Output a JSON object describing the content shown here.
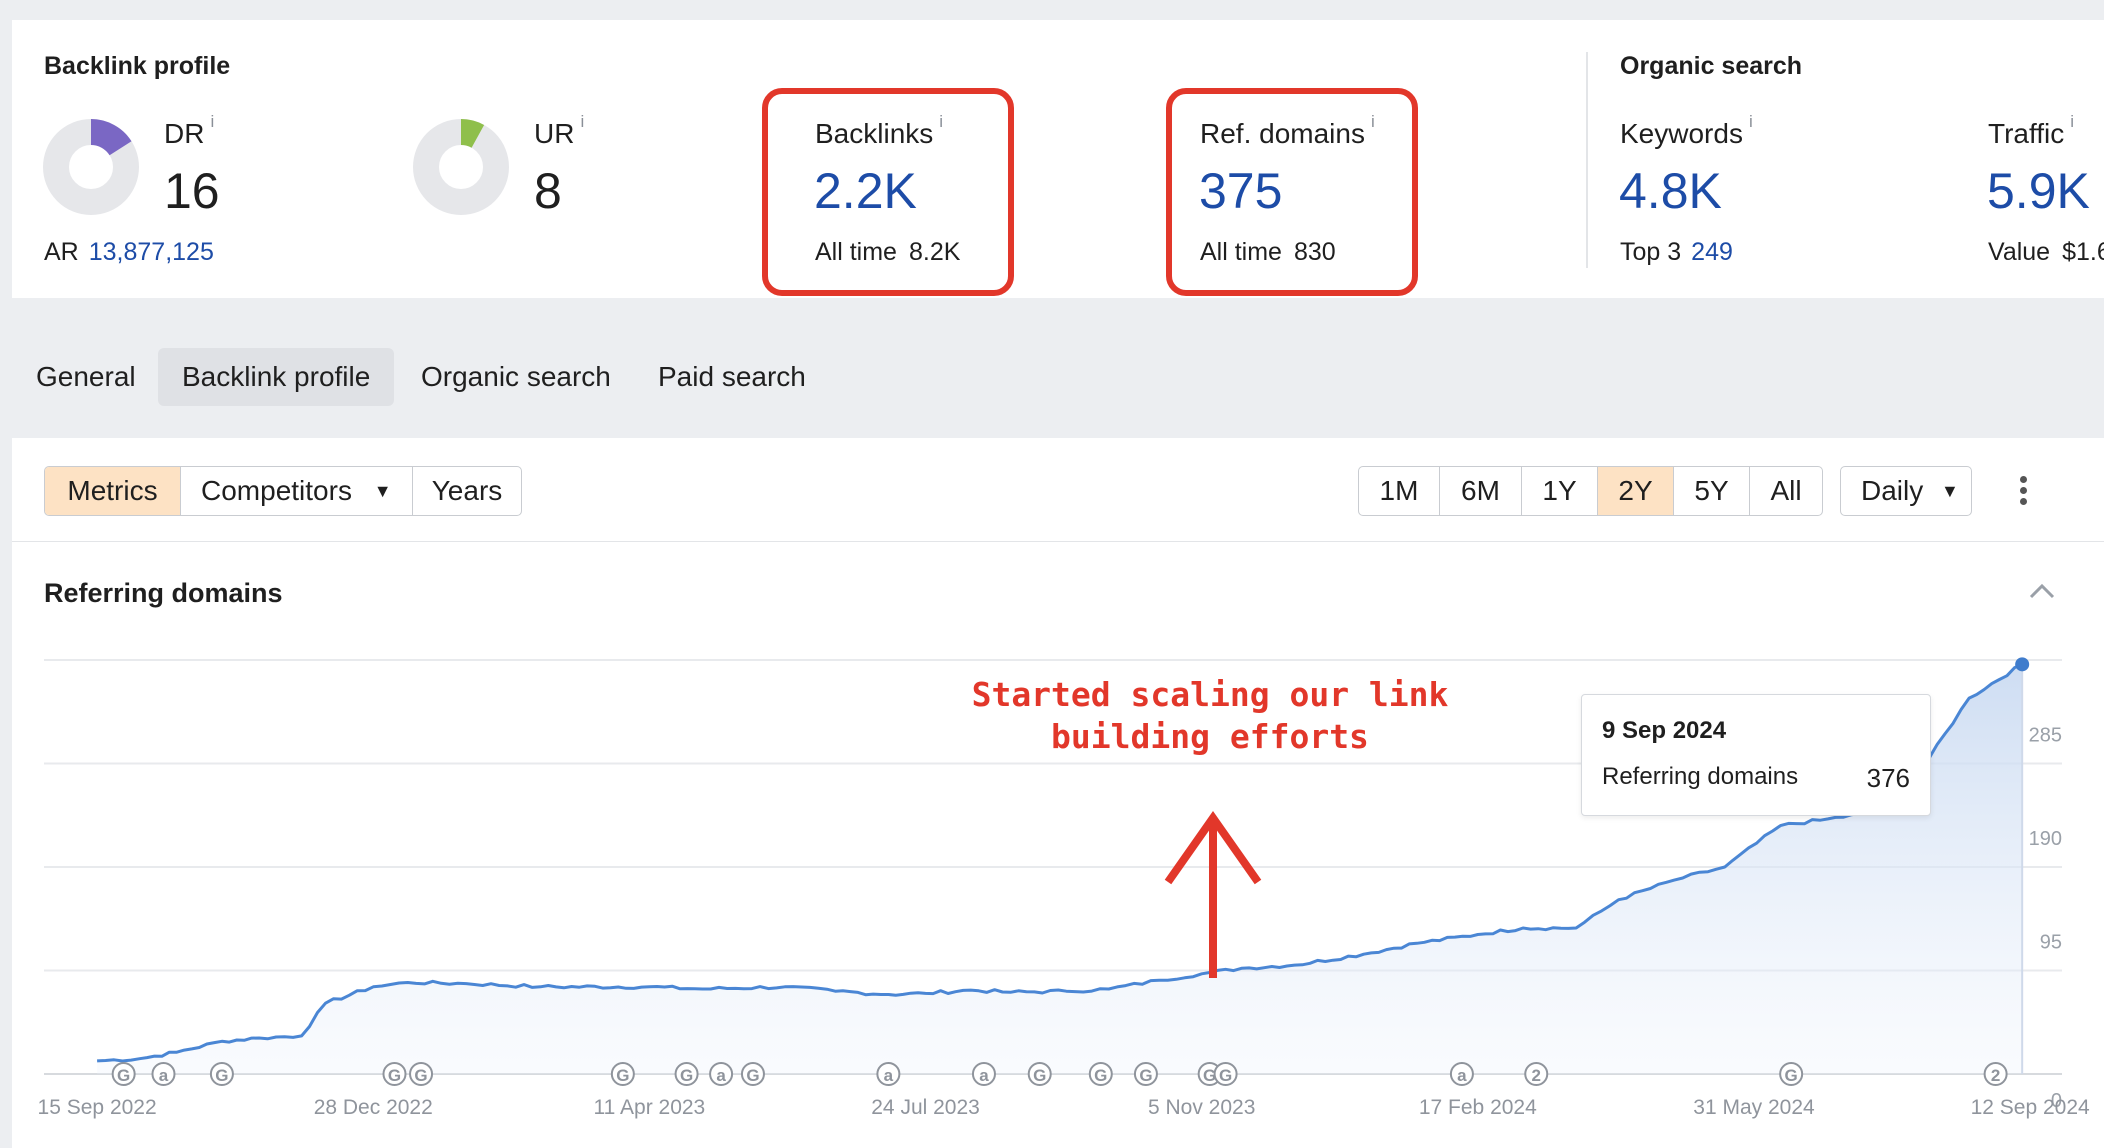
{
  "backlink_profile": {
    "title": "Backlink profile",
    "dr": {
      "label": "DR",
      "info": "i",
      "value": "16",
      "fraction": 0.16,
      "color": "#7a67c4"
    },
    "ar": {
      "label": "AR",
      "value": "13,877,125"
    },
    "ur": {
      "label": "UR",
      "info": "i",
      "value": "8",
      "fraction": 0.08,
      "color": "#8fbf4b"
    },
    "backlinks": {
      "label": "Backlinks",
      "info": "i",
      "value": "2.2K",
      "sub_label": "All time",
      "sub_value": "8.2K"
    },
    "ref_domains": {
      "label": "Ref. domains",
      "info": "i",
      "value": "375",
      "sub_label": "All time",
      "sub_value": "830"
    }
  },
  "organic_search": {
    "title": "Organic search",
    "keywords": {
      "label": "Keywords",
      "info": "i",
      "value": "4.8K",
      "sub_label": "Top 3",
      "sub_value": "249"
    },
    "traffic": {
      "label": "Traffic",
      "info": "i",
      "value": "5.9K",
      "sub_label": "Value",
      "sub_value": "$1.6"
    }
  },
  "tabs": [
    "General",
    "Backlink profile",
    "Organic search",
    "Paid search"
  ],
  "active_tab": "Backlink profile",
  "toolbar": {
    "metrics": "Metrics",
    "competitors": "Competitors",
    "years": "Years",
    "ranges": [
      "1M",
      "6M",
      "1Y",
      "2Y",
      "5Y",
      "All"
    ],
    "active_range": "2Y",
    "interval": "Daily"
  },
  "chart_section": {
    "title": "Referring domains"
  },
  "annotation": {
    "line1": "Started scaling our link",
    "line2": "building efforts"
  },
  "tooltip": {
    "date": "9 Sep 2024",
    "metric": "Referring domains",
    "value": "376"
  },
  "colors": {
    "accent": "#1d4ca7",
    "line": "#4a86d4",
    "highlight": "#e2372a",
    "active_toggle": "#fde2c4"
  },
  "chart_data": {
    "type": "line",
    "title": "Referring domains",
    "x_ticks": [
      "15 Sep 2022",
      "28 Dec 2022",
      "11 Apr 2023",
      "24 Jul 2023",
      "5 Nov 2023",
      "17 Feb 2024",
      "31 May 2024",
      "12 Sep 2024"
    ],
    "y_ticks": [
      0,
      95,
      190,
      285,
      380
    ],
    "ylim": [
      0,
      380
    ],
    "grid": true,
    "series": [
      {
        "values_by_date": [
          [
            "2022-09-15",
            12
          ],
          [
            "2022-10-01",
            14
          ],
          [
            "2022-10-15",
            20
          ],
          [
            "2022-11-01",
            30
          ],
          [
            "2022-11-15",
            33
          ],
          [
            "2022-12-01",
            35
          ],
          [
            "2022-12-10",
            65
          ],
          [
            "2022-12-28",
            80
          ],
          [
            "2023-01-10",
            84
          ],
          [
            "2023-02-01",
            83
          ],
          [
            "2023-03-01",
            80
          ],
          [
            "2023-04-11",
            80
          ],
          [
            "2023-05-01",
            78
          ],
          [
            "2023-06-01",
            80
          ],
          [
            "2023-06-20",
            76
          ],
          [
            "2023-07-10",
            73
          ],
          [
            "2023-07-24",
            74
          ],
          [
            "2023-08-10",
            77
          ],
          [
            "2023-08-25",
            75
          ],
          [
            "2023-09-15",
            76
          ],
          [
            "2023-10-01",
            78
          ],
          [
            "2023-10-20",
            86
          ],
          [
            "2023-11-05",
            92
          ],
          [
            "2023-11-20",
            97
          ],
          [
            "2023-12-10",
            100
          ],
          [
            "2024-01-05",
            110
          ],
          [
            "2024-01-25",
            120
          ],
          [
            "2024-02-17",
            128
          ],
          [
            "2024-03-05",
            134
          ],
          [
            "2024-03-25",
            134
          ],
          [
            "2024-04-10",
            160
          ],
          [
            "2024-05-01",
            178
          ],
          [
            "2024-05-20",
            190
          ],
          [
            "2024-06-10",
            228
          ],
          [
            "2024-06-25",
            233
          ],
          [
            "2024-07-15",
            240
          ],
          [
            "2024-08-05",
            290
          ],
          [
            "2024-08-20",
            345
          ],
          [
            "2024-09-09",
            376
          ]
        ]
      }
    ],
    "tooltip_point": {
      "x": "2024-09-09",
      "y": 376
    },
    "event_markers": [
      "G",
      "a",
      "G",
      "G",
      "G",
      "G",
      "G",
      "a",
      "G",
      "a",
      "a",
      "G",
      "G",
      "G",
      "G",
      "G",
      "a",
      "2",
      "G",
      "2"
    ]
  }
}
